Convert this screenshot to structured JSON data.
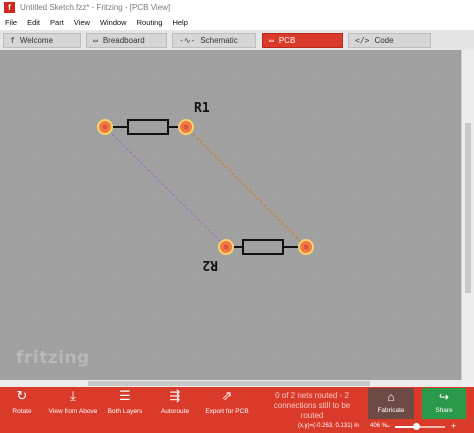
{
  "window": {
    "title": "Untitled Sketch.fzz* - Fritzing - [PCB View]",
    "app_icon_letter": "f"
  },
  "menu": [
    "File",
    "Edit",
    "Part",
    "View",
    "Window",
    "Routing",
    "Help"
  ],
  "tabs": [
    {
      "label": "Welcome",
      "icon": "welcome-icon",
      "glyph": "f",
      "active": false
    },
    {
      "label": "Breadboard",
      "icon": "breadboard-icon",
      "glyph": "▭",
      "active": false
    },
    {
      "label": "Schematic",
      "icon": "schematic-icon",
      "glyph": "-∿-",
      "active": false
    },
    {
      "label": "PCB",
      "icon": "pcb-icon",
      "glyph": "▭",
      "active": true
    },
    {
      "label": "Code",
      "icon": "code-icon",
      "glyph": "</>",
      "active": false
    }
  ],
  "canvas": {
    "background": "#a1a1a1",
    "watermark": "fritzing",
    "parts": [
      {
        "label": "R1",
        "mirrored": false
      },
      {
        "label": "R2",
        "mirrored": true
      }
    ],
    "colors": {
      "pad_fill": "#f07a45",
      "pad_ring": "#f7d36a",
      "ratsnest_top": "#c77b1e",
      "ratsnest_bottom": "#a26bc0",
      "silkscreen": "#111111"
    }
  },
  "toolbar": {
    "rotate": "Rotate",
    "view_from_above": "View from Above",
    "both_layers": "Both Layers",
    "autoroute": "Autoroute",
    "export_for_pcb": "Export for PCB",
    "routing_status": "0 of 2 nets routed - 2 connections still to be routed",
    "fabricate": "Fabricate",
    "share": "Share"
  },
  "status": {
    "coordinates": "(x,y)=(-0.263, 0.131) in",
    "zoom": "406 %",
    "zoom_level": 0.42
  },
  "accent_color": "#d93a2a"
}
